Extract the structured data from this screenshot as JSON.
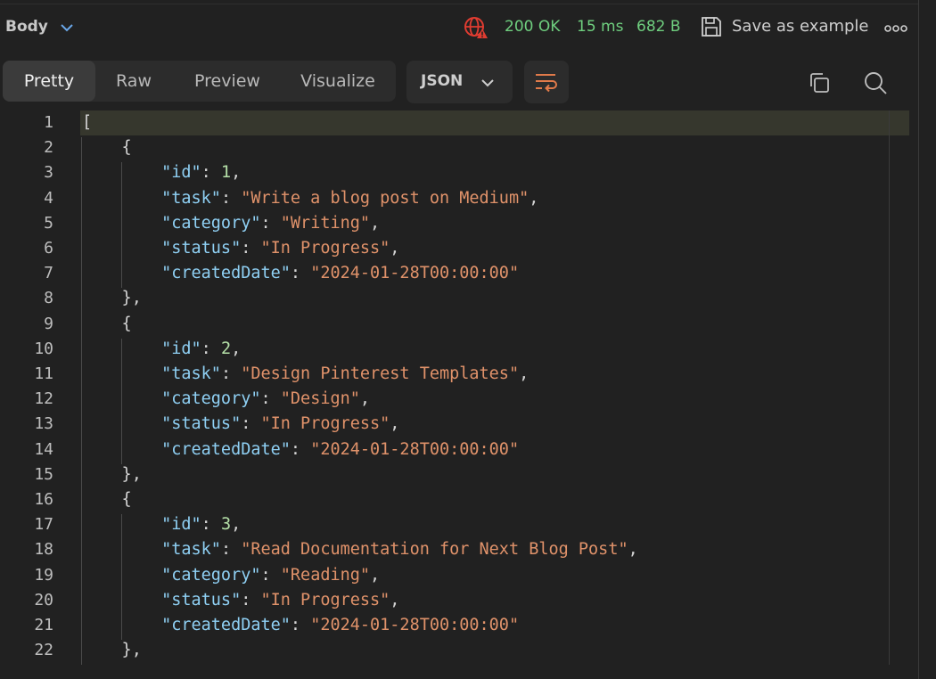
{
  "header": {
    "body_label": "Body",
    "status_code": "200 OK",
    "time": "15 ms",
    "size": "682 B",
    "save_label": "Save as example"
  },
  "view_tabs": [
    {
      "label": "Pretty",
      "active": true
    },
    {
      "label": "Raw",
      "active": false
    },
    {
      "label": "Preview",
      "active": false
    },
    {
      "label": "Visualize",
      "active": false
    }
  ],
  "format_select": {
    "value": "JSON"
  },
  "icons": {
    "body_chevron": "chevron-down-icon",
    "globe": "globe-warning-icon",
    "save": "save-icon",
    "more": "more-horizontal-icon",
    "format_chevron": "chevron-down-icon",
    "wrap": "text-wrap-icon",
    "copy": "copy-icon",
    "search": "search-icon"
  },
  "colors": {
    "background": "#212121",
    "status_ok": "#6fcf7f",
    "json_key": "#8fd0f4",
    "json_string": "#e0926a",
    "json_number": "#b5e0a8",
    "globe_warning": "#e03c31",
    "wrap_icon": "#e07a4a"
  },
  "lines": [
    {
      "n": "1",
      "tokens": [
        {
          "t": "p",
          "v": "["
        }
      ]
    },
    {
      "n": "2",
      "tokens": [
        {
          "t": "p",
          "v": "    {"
        }
      ]
    },
    {
      "n": "3",
      "tokens": [
        {
          "t": "p",
          "v": "        "
        },
        {
          "t": "k",
          "v": "\"id\""
        },
        {
          "t": "p",
          "v": ": "
        },
        {
          "t": "n",
          "v": "1"
        },
        {
          "t": "p",
          "v": ","
        }
      ]
    },
    {
      "n": "4",
      "tokens": [
        {
          "t": "p",
          "v": "        "
        },
        {
          "t": "k",
          "v": "\"task\""
        },
        {
          "t": "p",
          "v": ": "
        },
        {
          "t": "s",
          "v": "\"Write a blog post on Medium\""
        },
        {
          "t": "p",
          "v": ","
        }
      ]
    },
    {
      "n": "5",
      "tokens": [
        {
          "t": "p",
          "v": "        "
        },
        {
          "t": "k",
          "v": "\"category\""
        },
        {
          "t": "p",
          "v": ": "
        },
        {
          "t": "s",
          "v": "\"Writing\""
        },
        {
          "t": "p",
          "v": ","
        }
      ]
    },
    {
      "n": "6",
      "tokens": [
        {
          "t": "p",
          "v": "        "
        },
        {
          "t": "k",
          "v": "\"status\""
        },
        {
          "t": "p",
          "v": ": "
        },
        {
          "t": "s",
          "v": "\"In Progress\""
        },
        {
          "t": "p",
          "v": ","
        }
      ]
    },
    {
      "n": "7",
      "tokens": [
        {
          "t": "p",
          "v": "        "
        },
        {
          "t": "k",
          "v": "\"createdDate\""
        },
        {
          "t": "p",
          "v": ": "
        },
        {
          "t": "s",
          "v": "\"2024-01-28T00:00:00\""
        }
      ]
    },
    {
      "n": "8",
      "tokens": [
        {
          "t": "p",
          "v": "    },"
        }
      ]
    },
    {
      "n": "9",
      "tokens": [
        {
          "t": "p",
          "v": "    {"
        }
      ]
    },
    {
      "n": "10",
      "tokens": [
        {
          "t": "p",
          "v": "        "
        },
        {
          "t": "k",
          "v": "\"id\""
        },
        {
          "t": "p",
          "v": ": "
        },
        {
          "t": "n",
          "v": "2"
        },
        {
          "t": "p",
          "v": ","
        }
      ]
    },
    {
      "n": "11",
      "tokens": [
        {
          "t": "p",
          "v": "        "
        },
        {
          "t": "k",
          "v": "\"task\""
        },
        {
          "t": "p",
          "v": ": "
        },
        {
          "t": "s",
          "v": "\"Design Pinterest Templates\""
        },
        {
          "t": "p",
          "v": ","
        }
      ]
    },
    {
      "n": "12",
      "tokens": [
        {
          "t": "p",
          "v": "        "
        },
        {
          "t": "k",
          "v": "\"category\""
        },
        {
          "t": "p",
          "v": ": "
        },
        {
          "t": "s",
          "v": "\"Design\""
        },
        {
          "t": "p",
          "v": ","
        }
      ]
    },
    {
      "n": "13",
      "tokens": [
        {
          "t": "p",
          "v": "        "
        },
        {
          "t": "k",
          "v": "\"status\""
        },
        {
          "t": "p",
          "v": ": "
        },
        {
          "t": "s",
          "v": "\"In Progress\""
        },
        {
          "t": "p",
          "v": ","
        }
      ]
    },
    {
      "n": "14",
      "tokens": [
        {
          "t": "p",
          "v": "        "
        },
        {
          "t": "k",
          "v": "\"createdDate\""
        },
        {
          "t": "p",
          "v": ": "
        },
        {
          "t": "s",
          "v": "\"2024-01-28T00:00:00\""
        }
      ]
    },
    {
      "n": "15",
      "tokens": [
        {
          "t": "p",
          "v": "    },"
        }
      ]
    },
    {
      "n": "16",
      "tokens": [
        {
          "t": "p",
          "v": "    {"
        }
      ]
    },
    {
      "n": "17",
      "tokens": [
        {
          "t": "p",
          "v": "        "
        },
        {
          "t": "k",
          "v": "\"id\""
        },
        {
          "t": "p",
          "v": ": "
        },
        {
          "t": "n",
          "v": "3"
        },
        {
          "t": "p",
          "v": ","
        }
      ]
    },
    {
      "n": "18",
      "tokens": [
        {
          "t": "p",
          "v": "        "
        },
        {
          "t": "k",
          "v": "\"task\""
        },
        {
          "t": "p",
          "v": ": "
        },
        {
          "t": "s",
          "v": "\"Read Documentation for Next Blog Post\""
        },
        {
          "t": "p",
          "v": ","
        }
      ]
    },
    {
      "n": "19",
      "tokens": [
        {
          "t": "p",
          "v": "        "
        },
        {
          "t": "k",
          "v": "\"category\""
        },
        {
          "t": "p",
          "v": ": "
        },
        {
          "t": "s",
          "v": "\"Reading\""
        },
        {
          "t": "p",
          "v": ","
        }
      ]
    },
    {
      "n": "20",
      "tokens": [
        {
          "t": "p",
          "v": "        "
        },
        {
          "t": "k",
          "v": "\"status\""
        },
        {
          "t": "p",
          "v": ": "
        },
        {
          "t": "s",
          "v": "\"In Progress\""
        },
        {
          "t": "p",
          "v": ","
        }
      ]
    },
    {
      "n": "21",
      "tokens": [
        {
          "t": "p",
          "v": "        "
        },
        {
          "t": "k",
          "v": "\"createdDate\""
        },
        {
          "t": "p",
          "v": ": "
        },
        {
          "t": "s",
          "v": "\"2024-01-28T00:00:00\""
        }
      ]
    },
    {
      "n": "22",
      "tokens": [
        {
          "t": "p",
          "v": "    },"
        }
      ]
    }
  ]
}
